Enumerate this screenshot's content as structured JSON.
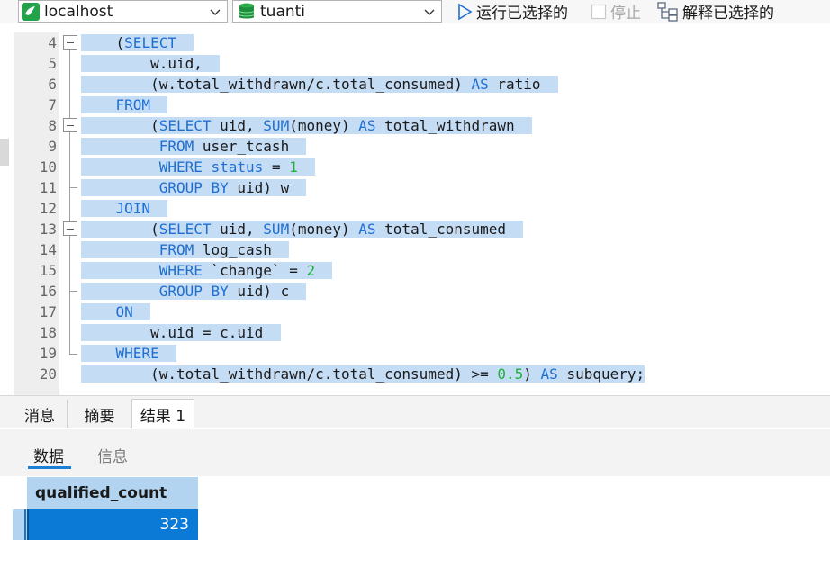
{
  "toolbar": {
    "connection": "localhost",
    "database": "tuanti",
    "run_selected": "运行已选择的",
    "stop": "停止",
    "explain_selected": "解释已选择的"
  },
  "editor": {
    "line_numbers": [
      "4",
      "5",
      "6",
      "7",
      "8",
      "9",
      "10",
      "11",
      "12",
      "13",
      "14",
      "15",
      "16",
      "17",
      "18",
      "19",
      "20"
    ],
    "lines": [
      [
        {
          "t": "    ("
        },
        {
          "t": "SELECT",
          "k": 1
        },
        {
          "t": "  "
        }
      ],
      [
        {
          "t": "        w.uid,  "
        }
      ],
      [
        {
          "t": "        (w.total_withdrawn/c.total_consumed) "
        },
        {
          "t": "AS",
          "k": 1
        },
        {
          "t": " ratio  "
        }
      ],
      [
        {
          "t": "    "
        },
        {
          "t": "FROM",
          "k": 1
        },
        {
          "t": "  "
        }
      ],
      [
        {
          "t": "        ("
        },
        {
          "t": "SELECT",
          "k": 1
        },
        {
          "t": " uid, "
        },
        {
          "t": "SUM",
          "k": 1
        },
        {
          "t": "(money) "
        },
        {
          "t": "AS",
          "k": 1
        },
        {
          "t": " total_withdrawn  "
        }
      ],
      [
        {
          "t": "         "
        },
        {
          "t": "FROM",
          "k": 1
        },
        {
          "t": " user_tcash  "
        }
      ],
      [
        {
          "t": "         "
        },
        {
          "t": "WHERE",
          "k": 1
        },
        {
          "t": " "
        },
        {
          "t": "status",
          "k": 1
        },
        {
          "t": " = "
        },
        {
          "t": "1",
          "n": 1
        },
        {
          "t": "  "
        }
      ],
      [
        {
          "t": "         "
        },
        {
          "t": "GROUP BY",
          "k": 1
        },
        {
          "t": " uid) w  "
        }
      ],
      [
        {
          "t": "    "
        },
        {
          "t": "JOIN",
          "k": 1
        },
        {
          "t": "  "
        }
      ],
      [
        {
          "t": "        ("
        },
        {
          "t": "SELECT",
          "k": 1
        },
        {
          "t": " uid, "
        },
        {
          "t": "SUM",
          "k": 1
        },
        {
          "t": "(money) "
        },
        {
          "t": "AS",
          "k": 1
        },
        {
          "t": " total_consumed  "
        }
      ],
      [
        {
          "t": "         "
        },
        {
          "t": "FROM",
          "k": 1
        },
        {
          "t": " log_cash  "
        }
      ],
      [
        {
          "t": "         "
        },
        {
          "t": "WHERE",
          "k": 1
        },
        {
          "t": " `change` = "
        },
        {
          "t": "2",
          "n": 1
        },
        {
          "t": "  "
        }
      ],
      [
        {
          "t": "         "
        },
        {
          "t": "GROUP BY",
          "k": 1
        },
        {
          "t": " uid) c  "
        }
      ],
      [
        {
          "t": "    "
        },
        {
          "t": "ON",
          "k": 1
        },
        {
          "t": "  "
        }
      ],
      [
        {
          "t": "        w.uid = c.uid  "
        }
      ],
      [
        {
          "t": "    "
        },
        {
          "t": "WHERE",
          "k": 1
        },
        {
          "t": "  "
        }
      ],
      [
        {
          "t": "        (w.total_withdrawn/c.total_consumed) >= "
        },
        {
          "t": "0.5",
          "n": 1
        },
        {
          "t": ") "
        },
        {
          "t": "AS",
          "k": 1
        },
        {
          "t": " subquery;"
        }
      ]
    ]
  },
  "result_tabs": [
    "消息",
    "摘要",
    "结果 1"
  ],
  "sub_tabs": [
    "数据",
    "信息"
  ],
  "grid": {
    "columns": [
      "qualified_count"
    ],
    "rows": [
      [
        "323"
      ]
    ]
  },
  "colors": {
    "keyword": "#1f6fd1",
    "number": "#1db136",
    "selection": "#c5dcf5",
    "accent": "#1b7fd6",
    "selected_cell": "#0a7ad6"
  },
  "icons": [
    "connection-icon",
    "chevron-down-icon",
    "database-icon",
    "run-icon",
    "stop-checkbox-icon",
    "explain-icon"
  ]
}
